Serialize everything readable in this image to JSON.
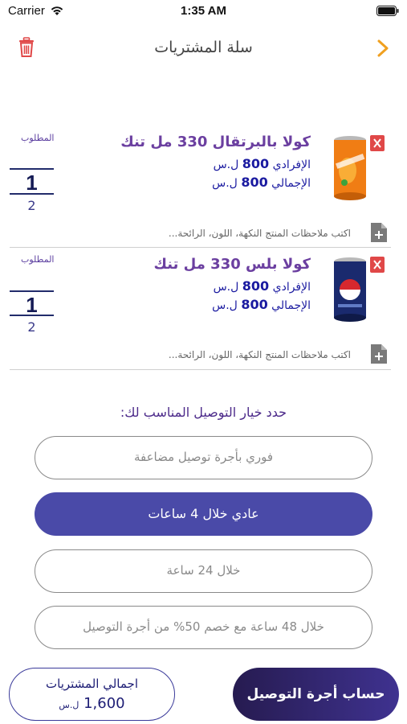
{
  "status_bar": {
    "carrier": "Carrier",
    "time": "1:35 AM"
  },
  "header": {
    "title": "سلة المشتريات"
  },
  "cart_items": [
    {
      "name": "كولا بالبرتقال 330 مل تنك",
      "unit_price_label": "الإفرادي",
      "unit_price": "800",
      "total_price_label": "الإجمالي",
      "total_price": "800",
      "currency": "ل.س",
      "qty_label": "المطلوب",
      "qty": "1",
      "qty_next": "2",
      "notes_placeholder": "اكتب ملاحظات المنتج النكهة، اللون، الرائحة..."
    },
    {
      "name": "كولا بلس 330 مل تنك",
      "unit_price_label": "الإفرادي",
      "unit_price": "800",
      "total_price_label": "الإجمالي",
      "total_price": "800",
      "currency": "ل.س",
      "qty_label": "المطلوب",
      "qty": "1",
      "qty_next": "2",
      "notes_placeholder": "اكتب ملاحظات المنتج النكهة، اللون، الرائحة..."
    }
  ],
  "delivery": {
    "heading": "حدد خيار التوصيل المناسب لك:",
    "options": [
      {
        "label": "فوري بأجرة توصيل مضاعفة",
        "selected": false
      },
      {
        "label": "عادي خلال 4 ساعات",
        "selected": true
      },
      {
        "label": "خلال 24 ساعة",
        "selected": false
      },
      {
        "label": "خلال 48 ساعة مع خصم 50% من أجرة التوصيل",
        "selected": false
      }
    ]
  },
  "footer": {
    "total_label": "اجمالي المشتريات",
    "total_value": "1,600",
    "currency": "ل.س",
    "calc_button": "حساب أجرة التوصيل"
  },
  "colors": {
    "accent": "#4a4aa8",
    "product_name": "#6b3fa0",
    "trash": "#e04848",
    "back_chevron": "#f0a020"
  },
  "icons": {
    "top_left": "trash-icon",
    "top_right": "chevron-right-icon",
    "item_delete": "trash-icon",
    "note_add": "add-document-icon"
  }
}
